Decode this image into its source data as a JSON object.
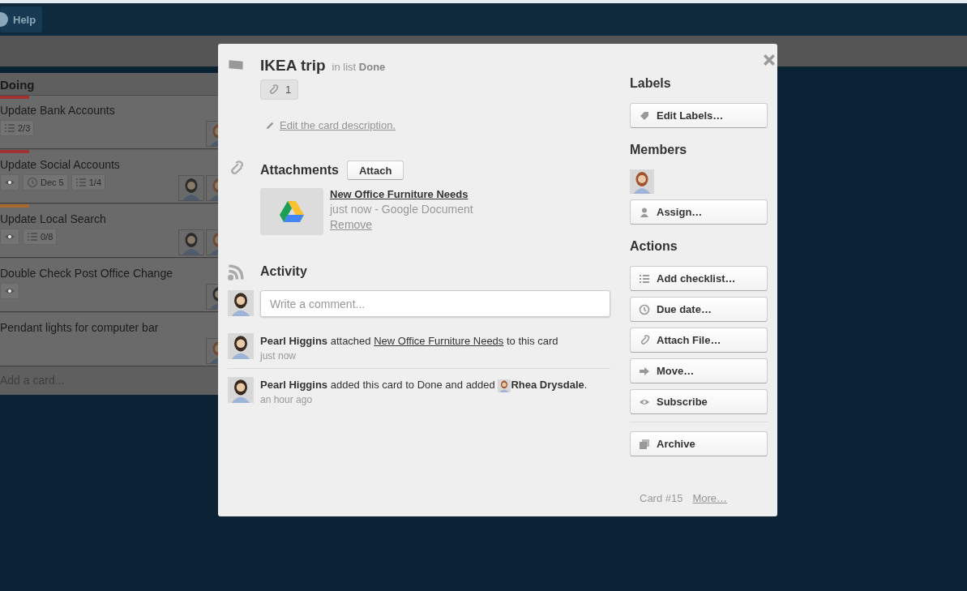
{
  "header": {
    "help_button": "Help"
  },
  "list": {
    "title": "Doing",
    "add_card": "Add a card...",
    "cards": [
      {
        "title": "Update Bank Accounts",
        "color": "#a03232",
        "badges": [
          {
            "kind": "checklist",
            "text": "2/3"
          }
        ],
        "members": [
          {
            "kind": "red-hair"
          }
        ]
      },
      {
        "title": "Update Social Accounts",
        "color": "#a03232",
        "badges": [
          {
            "kind": "watch"
          },
          {
            "kind": "due",
            "text": "Dec 5"
          },
          {
            "kind": "checklist",
            "text": "1/4"
          }
        ],
        "members": [
          {
            "kind": "dark-hair"
          },
          {
            "kind": "red-hair"
          }
        ]
      },
      {
        "title": "Update Local Search",
        "color": "#a8692c",
        "badges": [
          {
            "kind": "watch"
          },
          {
            "kind": "checklist",
            "text": "0/8"
          }
        ],
        "members": [
          {
            "kind": "dark-hair"
          },
          {
            "kind": "red-hair"
          }
        ]
      },
      {
        "title": "Double Check Post Office Change",
        "badges": [
          {
            "kind": "watch"
          }
        ],
        "members": [
          {
            "kind": "dark-hair"
          }
        ]
      },
      {
        "title": "Pendant lights for computer bar",
        "members": [
          {
            "kind": "red-hair"
          }
        ]
      }
    ]
  },
  "card_detail": {
    "title": "IKEA trip",
    "list_prefix": "in list",
    "list_name": "Done",
    "attachment_count": "1",
    "description_link": "Edit the card description.",
    "attachments": {
      "heading": "Attachments",
      "attach_button": "Attach",
      "items": [
        {
          "name": "New Office Furniture Needs",
          "meta": "just now - Google Document",
          "remove": "Remove"
        }
      ]
    },
    "activity": {
      "heading": "Activity",
      "comment": {
        "placeholder": "Write a comment..."
      },
      "items": [
        {
          "parts": [
            {
              "kind": "bold",
              "text": "Pearl Higgins"
            },
            {
              "kind": "text",
              "text": " attached "
            },
            {
              "kind": "link",
              "text": "New Office Furniture Needs"
            },
            {
              "kind": "text",
              "text": " to this card"
            }
          ],
          "time": "just now"
        },
        {
          "parts": [
            {
              "kind": "bold",
              "text": "Pearl Higgins"
            },
            {
              "kind": "text",
              "text": " added this card to Done and added "
            },
            {
              "kind": "avatar"
            },
            {
              "kind": "bold",
              "text": "Rhea Drysdale"
            },
            {
              "kind": "text",
              "text": "."
            }
          ],
          "time": "an hour ago"
        }
      ]
    },
    "sidebar": {
      "sections": [
        {
          "heading": "Labels",
          "buttons": [
            {
              "label": "Edit Labels…"
            }
          ]
        },
        {
          "heading": "Members",
          "members": [
            {
              "kind": "red-hair"
            }
          ],
          "buttons": [
            {
              "label": "Assign…"
            }
          ]
        },
        {
          "heading": "Actions",
          "buttons": [
            {
              "label": "Add checklist…"
            },
            {
              "label": "Due date…"
            },
            {
              "label": "Attach File…"
            },
            {
              "label": "Move…"
            },
            {
              "label": "Subscribe"
            },
            {
              "label": "Archive",
              "separated": true
            }
          ]
        }
      ],
      "card_number": "Card #15",
      "more_link": "More…"
    }
  }
}
